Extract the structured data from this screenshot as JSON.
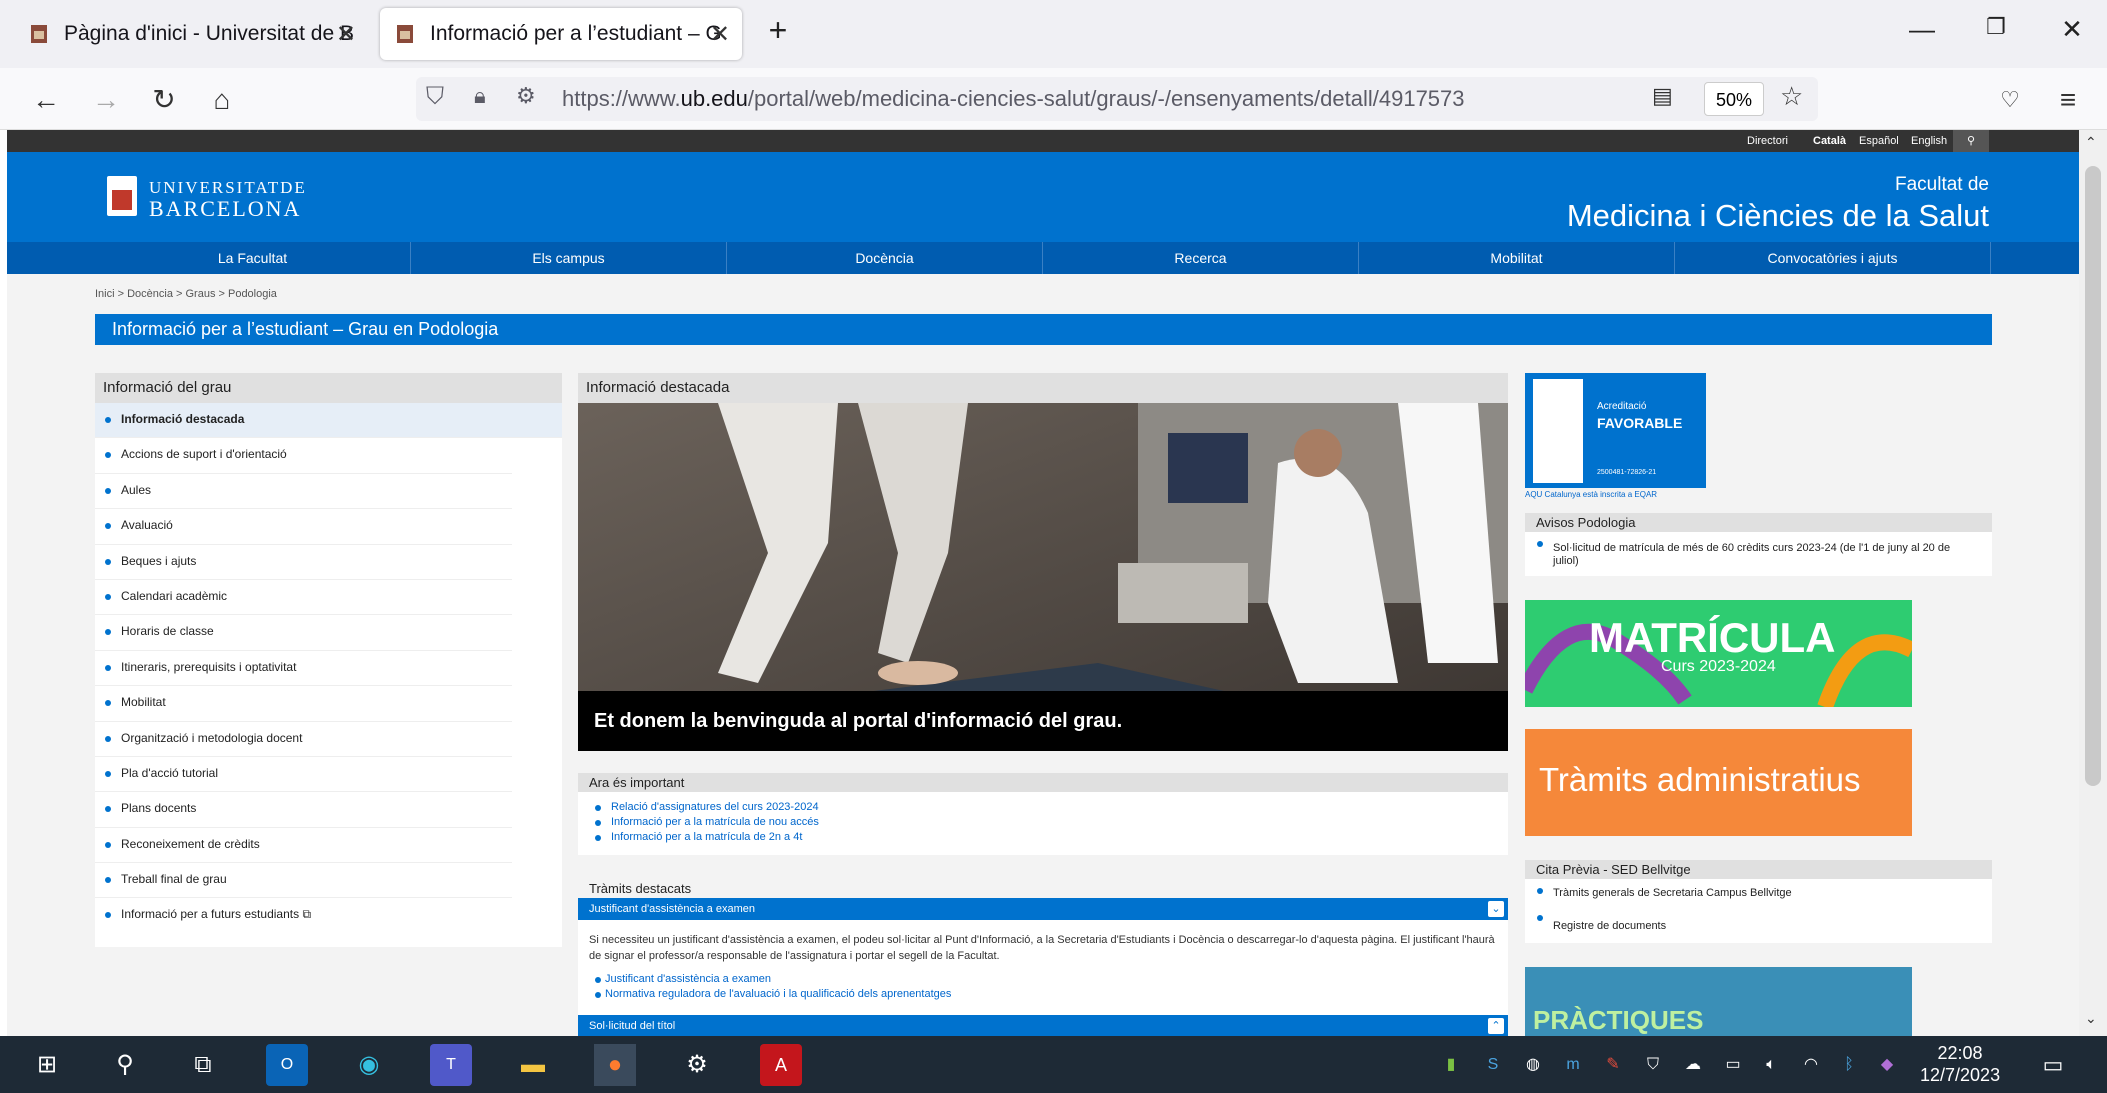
{
  "browser": {
    "tabs": [
      {
        "title": "Pàgina d'inici - Universitat de Ba",
        "active": false
      },
      {
        "title": "Informació per a l’estudiant – Gr",
        "active": true
      }
    ],
    "url_prefix": "https://www.",
    "url_domain": "ub.edu",
    "url_path": "/portal/web/medicina-ciencies-salut/graus/-/ensenyaments/detall/4917573",
    "zoom": "50%"
  },
  "site": {
    "topstrip": [
      "Directori",
      "Català",
      "Español",
      "English"
    ],
    "logo_line1": "UNIVERSITATDE",
    "logo_line2": "BARCELONA",
    "faculty_label": "Facultat de",
    "faculty_name": "Medicina i Ciències de la Salut",
    "menu": [
      "La Facultat",
      "Els campus",
      "Docència",
      "Recerca",
      "Mobilitat",
      "Convocatòries i ajuts"
    ],
    "breadcrumb": "Inici > Docència > Graus > Podologia",
    "page_title": "Informació per a l’estudiant – Grau en Podologia"
  },
  "left": {
    "heading": "Informació del grau",
    "items": [
      "Informació destacada",
      "Accions de suport i d'orientació",
      "Aules",
      "Avaluació",
      "Beques i ajuts",
      "Calendari acadèmic",
      "Horaris de classe",
      "Itineraris, prerequisits i optativitat",
      "Mobilitat",
      "Organització i metodologia docent",
      "Pla d'acció tutorial",
      "Plans docents",
      "Reconeixement de crèdits",
      "Treball final de grau",
      "Informació per a futurs estudiants"
    ]
  },
  "middle": {
    "heading": "Informació destacada",
    "hero_caption": "Et donem la benvinguda al portal d'informació del grau.",
    "important_heading": "Ara és important",
    "important_links": [
      "Relació d'assignatures del curs 2023-2024",
      "Informació per a la matrícula de nou accés",
      "Informació per a la matrícula de 2n a 4t"
    ],
    "tramits_heading": "Tràmits destacats",
    "accordion1": "Justificant d'assistència a examen",
    "accordion1_text": "Si necessiteu un justificant d'assistència a examen, el podeu sol·licitar al Punt d'Informació, a la Secretaria d'Estudiants i Docència o descarregar-lo d'aquesta pàgina. El justificant l'haurà de signar el professor/a responsable de l'assignatura i portar el segell de la Facultat.",
    "accordion1_links": [
      "Justificant d'assistència a examen",
      "Normativa reguladora de l'avaluació i la qualificació dels aprenentatges"
    ],
    "accordion2": "Sol·licitud del títol"
  },
  "right": {
    "badge_label": "Acreditació",
    "badge_value": "FAVORABLE",
    "badge_number": "2500481-72826-21",
    "aqu_text": "AQU Catalunya està inscrita a EQAR",
    "avisos_heading": "Avisos Podologia",
    "avisos_items": [
      "Sol·licitud de matrícula de més de 60 crèdits curs 2023-24 (de l'1 de juny al 20 de juliol)"
    ],
    "matricula_title": "MATRÍCULA",
    "matricula_sub": "Curs 2023-2024",
    "tramits_banner": "Tràmits administratius",
    "cita_heading": "Cita Prèvia - SED Bellvitge",
    "cita_items": [
      "Tràmits generals de Secretaria Campus Bellvitge",
      "Registre de documents"
    ],
    "practiques": "PRÀCTIQUES"
  },
  "taskbar": {
    "time": "22:08",
    "date": "12/7/2023"
  }
}
